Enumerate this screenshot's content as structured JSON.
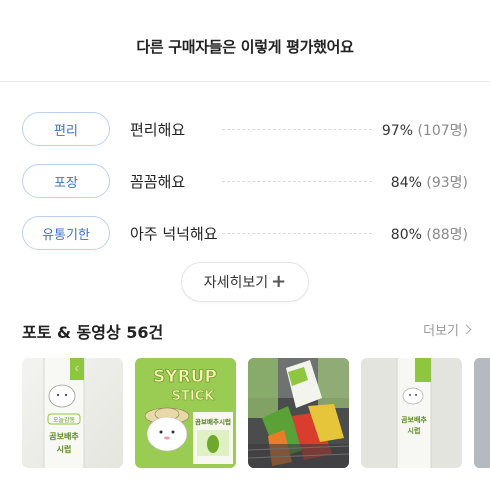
{
  "header": {
    "title": "다른 구매자들은 이렇게 평가했어요"
  },
  "ratings": [
    {
      "tag": "편리",
      "label": "편리해요",
      "percent": "97%",
      "count": "(107명)"
    },
    {
      "tag": "포장",
      "label": "꼼꼼해요",
      "percent": "84%",
      "count": "(93명)"
    },
    {
      "tag": "유통기한",
      "label": "아주 넉넉해요",
      "percent": "80%",
      "count": "(88명)"
    }
  ],
  "more_button": {
    "label": "자세히보기",
    "icon": "plus-icon"
  },
  "photos": {
    "title": "포토 & 동영상 56건",
    "see_all": "더보기",
    "see_all_icon": "chevron-right-icon",
    "items": [
      {
        "alt": "product-stick-photo",
        "package_text": [
          "오늘감동",
          "곰보배추",
          "시럽"
        ]
      },
      {
        "alt": "syrup-stick-box-photo",
        "package_text": [
          "SYRUP",
          "STICK",
          "곰보배추시럽"
        ]
      },
      {
        "alt": "product-in-basket-photo"
      },
      {
        "alt": "product-stick-closeup-photo",
        "package_text": [
          "곰보배추",
          "시럽"
        ]
      },
      {
        "alt": "partial-photo"
      }
    ]
  },
  "colors": {
    "tag_border": "#bcd1ee",
    "tag_text": "#3b73c7",
    "brand_green": "#8ec63f"
  }
}
